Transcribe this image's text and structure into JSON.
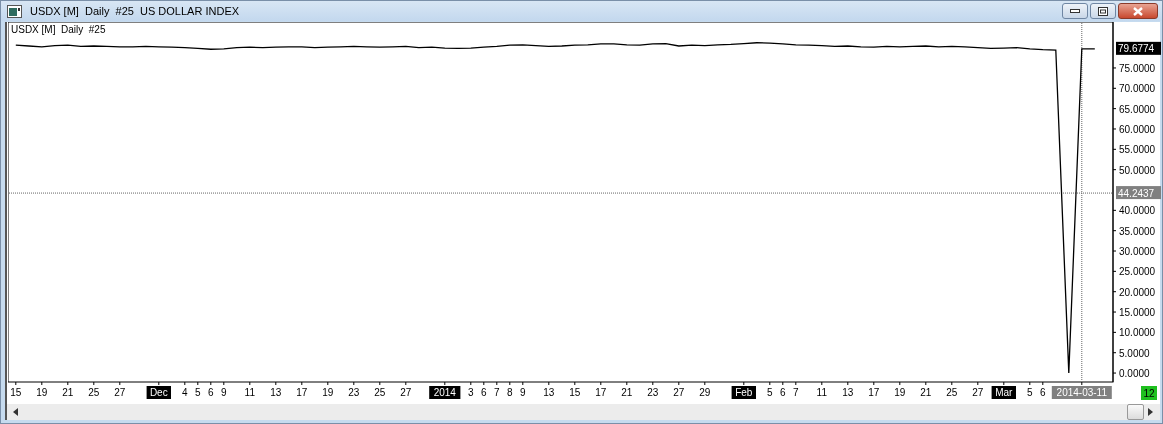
{
  "window": {
    "title": "USDX [M]  Daily  #25  US DOLLAR INDEX"
  },
  "chart": {
    "legend": "USDX [M]  Daily  #25",
    "bar_count": "12",
    "x_label_styles": [
      {
        "kind": "day"
      },
      {
        "kind": "day"
      },
      {
        "kind": "day"
      },
      {
        "kind": "day"
      },
      {
        "kind": "day"
      },
      {
        "kind": "month"
      },
      {
        "kind": "day"
      },
      {
        "kind": "day"
      },
      {
        "kind": "day"
      },
      {
        "kind": "day"
      },
      {
        "kind": "day"
      },
      {
        "kind": "day"
      },
      {
        "kind": "day"
      },
      {
        "kind": "day"
      },
      {
        "kind": "day"
      },
      {
        "kind": "day"
      },
      {
        "kind": "day"
      },
      {
        "kind": "month"
      },
      {
        "kind": "day"
      },
      {
        "kind": "day"
      },
      {
        "kind": "day"
      },
      {
        "kind": "day"
      },
      {
        "kind": "day"
      },
      {
        "kind": "day"
      },
      {
        "kind": "day"
      },
      {
        "kind": "day"
      },
      {
        "kind": "day"
      },
      {
        "kind": "day"
      },
      {
        "kind": "day"
      },
      {
        "kind": "day"
      },
      {
        "kind": "month"
      },
      {
        "kind": "day"
      },
      {
        "kind": "day"
      },
      {
        "kind": "day"
      },
      {
        "kind": "day"
      },
      {
        "kind": "day"
      },
      {
        "kind": "day"
      },
      {
        "kind": "day"
      },
      {
        "kind": "day"
      },
      {
        "kind": "day"
      },
      {
        "kind": "day"
      },
      {
        "kind": "month"
      },
      {
        "kind": "day"
      },
      {
        "kind": "day"
      },
      {
        "kind": "crosshair"
      }
    ],
    "chart_data": {
      "type": "line",
      "ylim": [
        -2.2,
        86.3
      ],
      "categories": [
        "15",
        null,
        "19",
        null,
        "21",
        null,
        "25",
        null,
        "27",
        null,
        null,
        "Dec",
        null,
        "4",
        "5",
        "6",
        "9",
        null,
        "11",
        null,
        "13",
        null,
        "17",
        null,
        "19",
        null,
        "23",
        null,
        "25",
        null,
        "27",
        null,
        null,
        "2014",
        null,
        "3",
        "6",
        "7",
        "8",
        "9",
        null,
        "13",
        null,
        "15",
        null,
        "17",
        null,
        "21",
        null,
        "23",
        null,
        "27",
        null,
        "29",
        null,
        null,
        "Feb",
        null,
        "5",
        "6",
        "7",
        null,
        "11",
        null,
        "13",
        null,
        "17",
        null,
        "19",
        null,
        "21",
        null,
        "25",
        null,
        "27",
        null,
        "Mar",
        null,
        "5",
        "6",
        null,
        null,
        "2014-03-11",
        null
      ],
      "series": [
        {
          "color": "#000000",
          "values": [
            80.6,
            80.4,
            80.2,
            80.5,
            80.6,
            80.3,
            80.4,
            80.3,
            80.2,
            80.2,
            80.3,
            80.2,
            80.1,
            80.0,
            79.8,
            79.6,
            79.7,
            80.0,
            80.1,
            80.0,
            80.1,
            80.2,
            80.2,
            80.0,
            80.1,
            80.2,
            80.3,
            80.2,
            80.1,
            80.2,
            80.3,
            80.0,
            80.1,
            79.9,
            79.8,
            79.9,
            80.1,
            80.3,
            80.6,
            80.7,
            80.5,
            80.3,
            80.4,
            80.6,
            80.7,
            80.9,
            80.9,
            80.7,
            80.6,
            80.9,
            81.0,
            80.4,
            80.6,
            80.5,
            80.7,
            80.8,
            81.0,
            81.2,
            81.1,
            80.9,
            80.7,
            80.6,
            80.5,
            80.3,
            80.4,
            80.2,
            80.1,
            80.3,
            80.2,
            80.3,
            80.4,
            80.2,
            80.3,
            80.2,
            80.0,
            79.8,
            79.9,
            80.0,
            79.7,
            79.5,
            79.4,
            0,
            79.7,
            79.7
          ]
        }
      ],
      "yticks": [
        {
          "value": 0,
          "label": "0.0000"
        },
        {
          "value": 5,
          "label": "5.0000"
        },
        {
          "value": 10,
          "label": "10.0000"
        },
        {
          "value": 15,
          "label": "15.0000"
        },
        {
          "value": 20,
          "label": "20.0000"
        },
        {
          "value": 25,
          "label": "25.0000"
        },
        {
          "value": 30,
          "label": "30.0000"
        },
        {
          "value": 35,
          "label": "35.0000"
        },
        {
          "value": 40,
          "label": "40.0000"
        },
        {
          "value": 50,
          "label": "50.0000"
        },
        {
          "value": 55,
          "label": "55.0000"
        },
        {
          "value": 60,
          "label": "60.0000"
        },
        {
          "value": 65,
          "label": "65.0000"
        },
        {
          "value": 70,
          "label": "70.0000"
        },
        {
          "value": 75,
          "label": "75.0000"
        }
      ],
      "ref_lines": [
        {
          "axis": "y",
          "value": 44.2437,
          "label": "44.2437"
        },
        {
          "axis": "x",
          "value": "2014-03-11"
        }
      ],
      "annotations": [
        "79.6774"
      ]
    }
  }
}
